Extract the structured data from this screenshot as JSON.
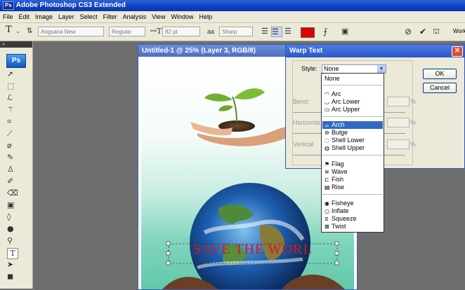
{
  "app": {
    "title": "Adobe Photoshop CS3 Extended",
    "logo": "Ps"
  },
  "menu": [
    "File",
    "Edit",
    "Image",
    "Layer",
    "Select",
    "Filter",
    "Analysis",
    "View",
    "Window",
    "Help"
  ],
  "options": {
    "font_family": "Angsana New",
    "font_style": "Regular",
    "font_size": "82 pt",
    "anti_alias": "Sharp",
    "color": "#e00000",
    "workspace": "Work"
  },
  "tools": {
    "dock": "»",
    "logo": "Ps"
  },
  "document": {
    "title": "Untitled-1 @ 25% (Layer 3, RGB/8)",
    "text": "SAVE THE WORL"
  },
  "dialog": {
    "title": "Warp Text",
    "style_label": "Style:",
    "style_value": "None",
    "ok": "OK",
    "cancel": "Cancel",
    "bend_label": "Bend:",
    "horizontal_label": "Horizonta",
    "vertical_label": "Vertical",
    "percent": "%"
  },
  "style_options": [
    {
      "label": "None",
      "icon": ""
    },
    {
      "label": "Arc",
      "icon": "◠"
    },
    {
      "label": "Arc Lower",
      "icon": "◡"
    },
    {
      "label": "Arc Upper",
      "icon": "▭"
    },
    {
      "label": "Arch",
      "icon": "⌓"
    },
    {
      "label": "Bulge",
      "icon": "⊖"
    },
    {
      "label": "Shell Lower",
      "icon": "◌"
    },
    {
      "label": "Shell Upper",
      "icon": "◍"
    },
    {
      "label": "Flag",
      "icon": "⚑"
    },
    {
      "label": "Wave",
      "icon": "≋"
    },
    {
      "label": "Fish",
      "icon": "⊏"
    },
    {
      "label": "Rise",
      "icon": "▤"
    },
    {
      "label": "Fisheye",
      "icon": "◉"
    },
    {
      "label": "Inflate",
      "icon": "○"
    },
    {
      "label": "Squeeze",
      "icon": "⧖"
    },
    {
      "label": "Twist",
      "icon": "⊠"
    }
  ]
}
